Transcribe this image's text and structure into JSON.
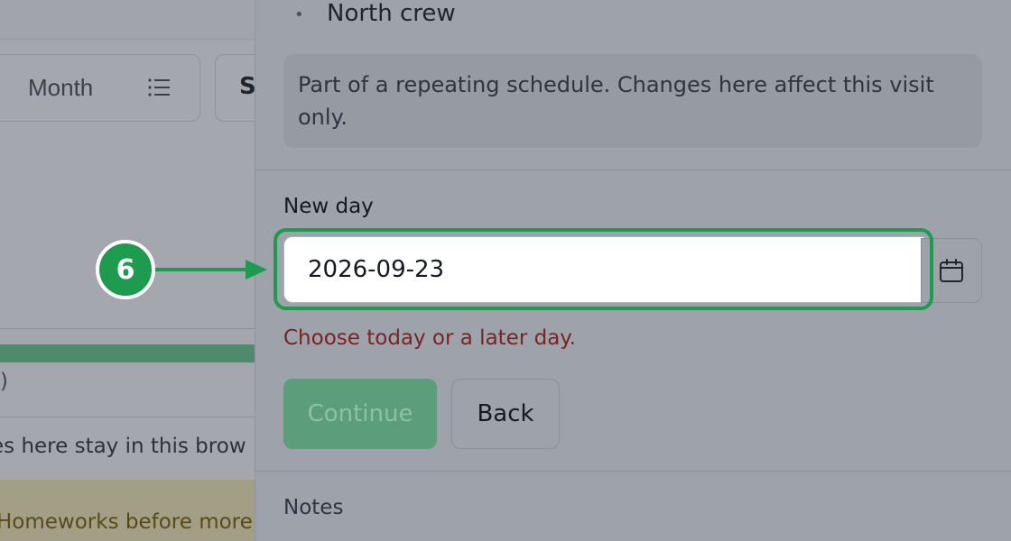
{
  "background": {
    "view_button": "Month",
    "next_button_partial": "S",
    "progress_caption_partial": ")",
    "storage_hint_partial": "es here stay in this brow",
    "warning_partial": "Homeworks before more"
  },
  "drawer": {
    "crew": "North crew",
    "info_note": "Part of a repeating schedule. Changes here affect this visit only.",
    "date_field": {
      "label": "New day",
      "value": "2026-09-23",
      "error": "Choose today or a later day."
    },
    "actions": {
      "continue": "Continue",
      "back": "Back"
    },
    "notes_label": "Notes"
  },
  "annotation": {
    "step_number": "6",
    "color": "#1e9b4f"
  },
  "colors": {
    "accent_green": "#1e9b4f",
    "error_red": "#7a2323",
    "overlay_gray": "#9ea2ab"
  },
  "icons": {
    "list": "list-icon",
    "calendar": "calendar-icon",
    "arrow": "arrow-right-icon"
  }
}
